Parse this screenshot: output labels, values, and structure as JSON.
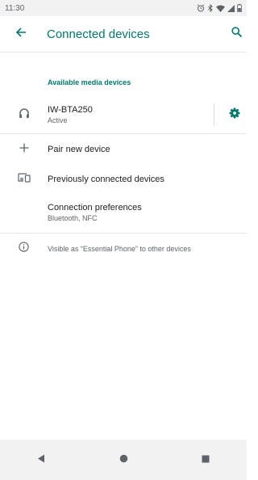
{
  "status_bar": {
    "time": "11:30",
    "icons": [
      "alarm-icon",
      "bluetooth-icon",
      "wifi-icon",
      "signal-icon",
      "battery-icon"
    ]
  },
  "app_bar": {
    "title": "Connected devices",
    "back_icon": "arrow-back-icon",
    "search_icon": "search-icon"
  },
  "media": {
    "header": "Available media devices",
    "device": {
      "name": "IW-BTA250",
      "status": "Active",
      "icon": "headphones-icon"
    }
  },
  "items": {
    "pair_new": "Pair new device",
    "previously_connected": "Previously connected devices",
    "preferences_title": "Connection preferences",
    "preferences_sub": "Bluetooth, NFC"
  },
  "footer": {
    "text": "Visible as “Essential Phone” to other devices"
  },
  "nav": {
    "buttons": [
      "back-triangle-icon",
      "home-circle-icon",
      "recents-square-icon"
    ]
  },
  "colors": {
    "accent": "#00796b",
    "status_bar_bg": "#f2f2f2"
  }
}
